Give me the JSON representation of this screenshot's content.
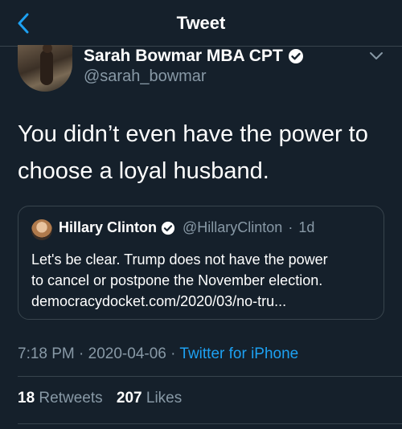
{
  "nav": {
    "title": "Tweet",
    "back_icon": "chevron-left-icon",
    "accent": "#1da1f2"
  },
  "author": {
    "name": "Sarah Bowmar MBA CPT",
    "handle": "@sarah_bowmar",
    "verified": true
  },
  "tweet": {
    "text": "You didn’t even have the power to choose a loyal husband."
  },
  "quoted": {
    "name": "Hillary Clinton",
    "handle": "@HillaryClinton",
    "separator": "·",
    "age": "1d",
    "verified": true,
    "text_line1": "Let's be clear. Trump does not have the power",
    "text_line2": "to cancel or postpone the November election.",
    "text_line3": "democracydocket.com/2020/03/no-tru..."
  },
  "meta": {
    "time": "7:18 PM",
    "sep1": "·",
    "date": "2020-04-06",
    "sep2": "·",
    "source": "Twitter for iPhone"
  },
  "stats": {
    "retweets_count": "18",
    "retweets_label": "Retweets",
    "likes_count": "207",
    "likes_label": "Likes"
  },
  "colors": {
    "background": "#15202b",
    "secondary_text": "#8899a6",
    "border": "#38444d",
    "link": "#1da1f2"
  }
}
